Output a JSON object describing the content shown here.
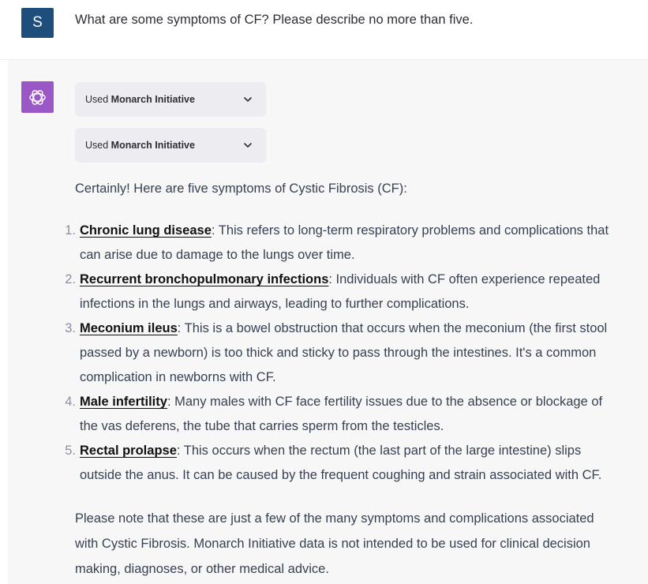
{
  "user_message": {
    "avatar_initial": "S",
    "text": "What are some symptoms of CF? Please describe no more than five."
  },
  "assistant": {
    "avatar_icon": "openai-logo-icon",
    "plugins": [
      {
        "prefix": "Used",
        "name": "Monarch Initiative"
      },
      {
        "prefix": "Used",
        "name": "Monarch Initiative"
      }
    ],
    "intro": "Certainly! Here are five symptoms of Cystic Fibrosis (CF):",
    "symptoms": [
      {
        "number": "1.",
        "term": "Chronic lung disease",
        "lines": [
          ": This refers to long-term respiratory problems and complications that",
          "can arise due to damage to the lungs over time."
        ]
      },
      {
        "number": "2.",
        "term": "Recurrent bronchopulmonary infections",
        "lines": [
          ": Individuals with CF often experience repeated",
          "infections in the lungs and airways, leading to further complications."
        ]
      },
      {
        "number": "3.",
        "term": "Meconium ileus",
        "lines": [
          ": This is a bowel obstruction that occurs when the meconium (the first stool",
          "passed by a newborn) is too thick and sticky to pass through the intestines. It's a common",
          "complication in newborns with CF."
        ]
      },
      {
        "number": "4.",
        "term": "Male infertility",
        "lines": [
          ": Many males with CF face fertility issues due to the absence or blockage of",
          "the vas deferens, the tube that carries sperm from the testicles."
        ]
      },
      {
        "number": "5.",
        "term": "Rectal prolapse",
        "lines": [
          ": This occurs when the rectum (the last part of the large intestine) slips",
          "outside the anus. It can be caused by the frequent coughing and strain associated with CF."
        ]
      }
    ],
    "outro_lines": [
      "Please note that these are just a few of the many symptoms and complications associated",
      "with Cystic Fibrosis. Monarch Initiative data is not intended to be used for clinical decision",
      "making, diagnoses, or other medical advice."
    ]
  },
  "colors": {
    "user_avatar": "#1e4f7c",
    "assistant_avatar": "#9a57c6",
    "assistant_background": "#f7f7f8",
    "plugin_pill": "#ececf1"
  }
}
